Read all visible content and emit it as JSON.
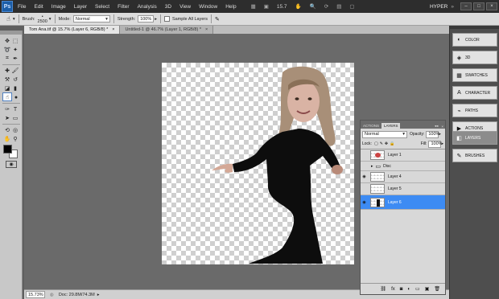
{
  "menubar": {
    "app_icon": "Ps",
    "items": [
      "File",
      "Edit",
      "Image",
      "Layer",
      "Select",
      "Filter",
      "Analysis",
      "3D",
      "View",
      "Window",
      "Help"
    ],
    "zoom_value": "15.7",
    "workspace": "HYPER",
    "window_controls": [
      "–",
      "□",
      "×"
    ]
  },
  "options": {
    "brush_label": "Brush:",
    "brush_size": "2500",
    "mode_label": "Mode:",
    "mode_value": "Normal",
    "strength_label": "Strength:",
    "strength_value": "100%",
    "sample_all_label": "Sample All Layers"
  },
  "tabs": [
    {
      "label": "Tom Ana.tif @ 15.7% (Layer 6, RGB/8) *",
      "close": "×"
    },
    {
      "label": "Untitled-1 @ 46.7% (Layer 1, RGB/8) *",
      "close": "×"
    }
  ],
  "status": {
    "zoom": "15.73%",
    "doc": "Doc: 29.8M/74.3M"
  },
  "dock": {
    "items": [
      {
        "label": "COLOR",
        "icon": "color-icon"
      },
      {
        "label": "3D",
        "icon": "3d-icon"
      },
      {
        "label": "SWATCHES",
        "icon": "swatches-icon"
      },
      {
        "label": "CHARACTER",
        "icon": "character-icon"
      },
      {
        "label": "PATHS",
        "icon": "paths-icon"
      },
      {
        "label": "ACTIONS",
        "icon": "actions-icon"
      },
      {
        "label": "LAYERS",
        "icon": "layers-icon"
      },
      {
        "label": "BRUSHES",
        "icon": "brushes-icon"
      }
    ]
  },
  "layers_panel": {
    "tabs": [
      "ACTIONS",
      "LAYERS"
    ],
    "blend_mode": "Normal",
    "opacity_label": "Opacity:",
    "opacity_value": "100%",
    "lock_label": "Lock:",
    "fill_label": "Fill:",
    "fill_value": "100%",
    "layers": [
      {
        "name": "Layer 1",
        "visible": false,
        "selected": false
      },
      {
        "name": "Disc",
        "visible": false,
        "selected": false,
        "group": true
      },
      {
        "name": "Layer 4",
        "visible": true,
        "selected": false
      },
      {
        "name": "Layer 5",
        "visible": false,
        "selected": false
      },
      {
        "name": "Layer 6",
        "visible": true,
        "selected": true
      }
    ]
  }
}
